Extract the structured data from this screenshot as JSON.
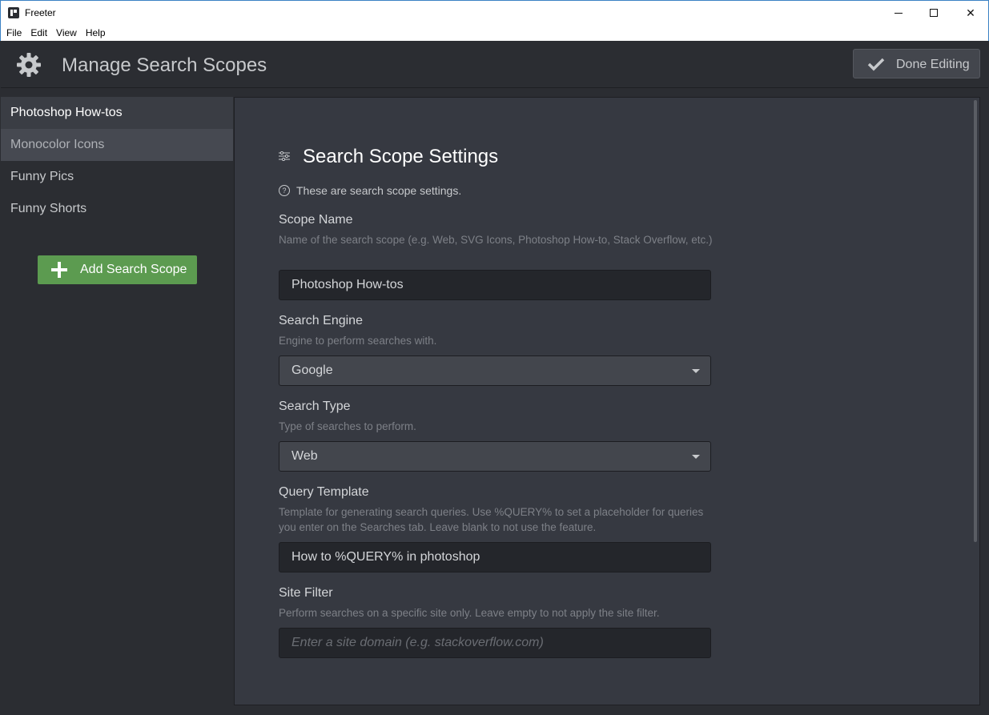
{
  "window": {
    "title": "Freeter",
    "minimize_glyph": "",
    "maximize_glyph": "",
    "close_glyph": "✕"
  },
  "menu": [
    "File",
    "Edit",
    "View",
    "Help"
  ],
  "header": {
    "icon": "gear-icon",
    "title": "Manage Search Scopes",
    "done_button": {
      "icon": "check-icon",
      "label": "Done Editing"
    }
  },
  "sidebar": {
    "items": [
      {
        "label": "Photoshop How-tos",
        "state": "active"
      },
      {
        "label": "Monocolor Icons",
        "state": "hover"
      },
      {
        "label": "Funny Pics",
        "state": "normal"
      },
      {
        "label": "Funny Shorts",
        "state": "normal"
      }
    ],
    "add_button": {
      "icon": "plus-icon",
      "label": "Add Search Scope"
    }
  },
  "settings": {
    "title": "Search Scope Settings",
    "title_icon": "sliders-icon",
    "help_icon": "?",
    "help_text": "These are search scope settings.",
    "scope_name": {
      "label": "Scope Name",
      "description": "Name of the search scope (e.g. Web, SVG Icons, Photoshop How-to, Stack Overflow, etc.)",
      "value": "Photoshop How-tos"
    },
    "search_engine": {
      "label": "Search Engine",
      "description": "Engine to perform searches with.",
      "selected": "Google"
    },
    "search_type": {
      "label": "Search Type",
      "description": "Type of searches to perform.",
      "selected": "Web"
    },
    "query_template": {
      "label": "Query Template",
      "description": "Template for generating search queries. Use %QUERY% to set a placeholder for queries you enter on the Searches tab. Leave blank to not use the feature.",
      "value": "How to %QUERY% in photoshop"
    },
    "site_filter": {
      "label": "Site Filter",
      "description": "Perform searches on a specific site only. Leave empty to not apply the site filter.",
      "value": "",
      "placeholder": "Enter a site domain (e.g. stackoverflow.com)"
    }
  },
  "colors": {
    "background": "#2b2d32",
    "panel": "#363941",
    "accent_green": "#5c9b50",
    "text_primary": "#d4d6d9",
    "text_muted": "#7d8087"
  }
}
